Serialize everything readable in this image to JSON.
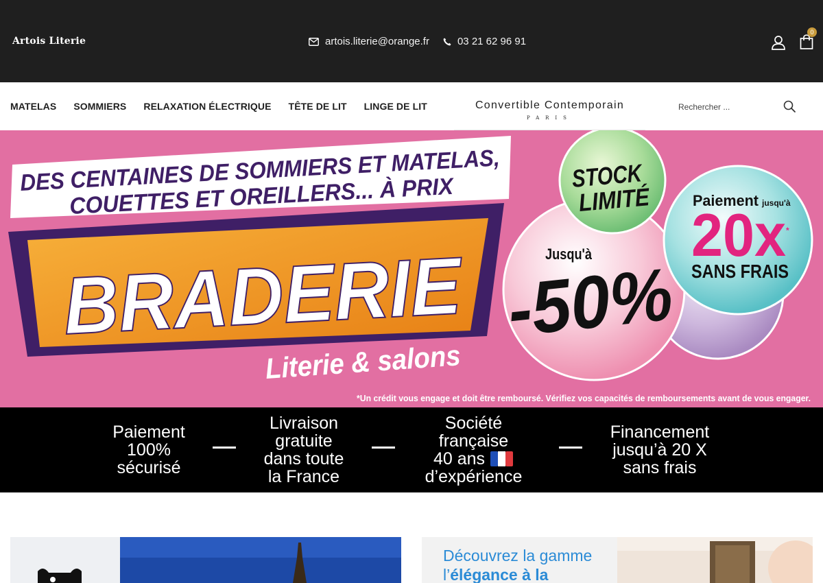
{
  "header": {
    "logo": "Artois Literie",
    "email": "artois.literie@orange.fr",
    "phone": "03 21 62 96 91",
    "cart_count": "0"
  },
  "nav": {
    "items": [
      {
        "label": "MATELAS"
      },
      {
        "label": "SOMMIERS"
      },
      {
        "label": "RELAXATION ÉLECTRIQUE"
      },
      {
        "label": "TÊTE DE LIT"
      },
      {
        "label": "LINGE DE LIT"
      }
    ],
    "brand_main": "Convertible Contemporain",
    "brand_sub": "PARIS",
    "search_placeholder": "Rechercher ..."
  },
  "hero": {
    "headline_line1": "DES CENTAINES DE SOMMIERS ET MATELAS,",
    "headline_line2": "COUETTES ET OREILLERS... À PRIX",
    "title": "BRADERIE",
    "subtitle": "Literie & salons",
    "bubble_stock_1": "STOCK",
    "bubble_stock_2": "LIMITÉ",
    "bubble_pay_1": "Paiement",
    "bubble_pay_small": "jusqu'à",
    "bubble_pay_2": "20x",
    "bubble_pay_star": "*",
    "bubble_pay_3": "SANS FRAIS",
    "bubble_disc_1": "Jusqu'à",
    "bubble_disc_2": "-50%",
    "disclaimer": "*Un crédit vous engage et doit être remboursé. Vérifiez vos capacités de remboursements avant de vous engager.",
    "colors": {
      "background": "#e26fa2",
      "purple": "#3f1f66",
      "orange": "#f29a1e",
      "white": "#ffffff"
    }
  },
  "features": [
    {
      "lines": [
        "Paiement",
        "100%",
        "sécurisé"
      ]
    },
    {
      "lines": [
        "Livraison",
        "gratuite",
        "dans toute",
        "la France"
      ]
    },
    {
      "lines": [
        "Société",
        "française",
        "40 ans",
        "d’expérience"
      ]
    },
    {
      "lines": [
        "Financement",
        "jusqu’à 20 X",
        "sans frais"
      ]
    }
  ],
  "promo_right": {
    "line1": "Découvrez la gamme",
    "line2_prefix": "l’",
    "line2_bold": "élégance à la"
  }
}
